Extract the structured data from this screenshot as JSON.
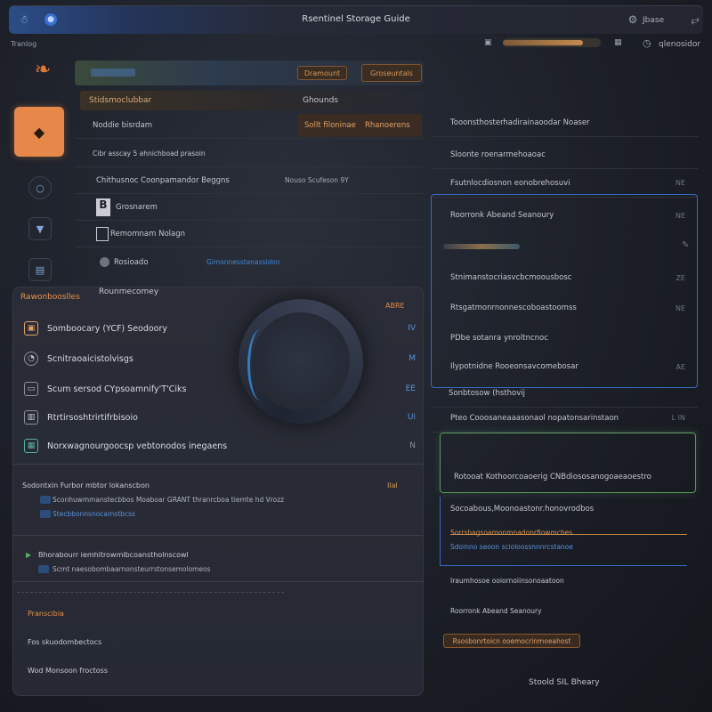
{
  "window": {
    "title": "Rsentinel Storage Guide",
    "user_name": "Jbase"
  },
  "menu": {
    "label": "Tranlog",
    "progress": 0.82,
    "account_label": "qlenosidor"
  },
  "header": {
    "action_small": "Dramount",
    "action_large": "Groseuntals"
  },
  "table": {
    "col_left": "Stidsmoclubbar",
    "col_right": "Ghounds",
    "highlight_a": "Sollt filoninae",
    "highlight_b": "Rhanoerens",
    "rows": [
      {
        "label": "Noddie bisrdam",
        "extra": ""
      },
      {
        "label": "Cibr asscay 5 ahnichboad prasoin",
        "extra": ""
      },
      {
        "label": "Chithusnoc Coonpamandor Beggns",
        "extra": "Nouso Scufeson 9Y"
      },
      {
        "label": "Grosnarem",
        "extra": ""
      },
      {
        "label": "Remomnam Nolagn",
        "extra": ""
      },
      {
        "label": "Rosioado",
        "extra": "Gimonnesstanassidon"
      }
    ]
  },
  "card": {
    "heading": "Rawonbooslles",
    "subheading": "Rounmecomey",
    "badge": "ABRE",
    "rows": [
      {
        "label": "Somboocary (YCF) Seodoory",
        "value": "IV"
      },
      {
        "label": "Scnitraoaicistolvisgs",
        "value": "M"
      },
      {
        "label": "Scum sersod CYpsoamnify'T'Ciks",
        "value": "EE"
      },
      {
        "label": "Rtrtirsoshtrirtifrbisoio",
        "value": "Ui"
      },
      {
        "label": "Norxwagnourgoocsp vebtonodos inegaens",
        "value": "N"
      }
    ],
    "section1_title": "Sodontxin Furbor mbtor lokanscbon",
    "section1_badge": "Ilal",
    "section1_line": "Sconhuwmmanstecbbos Moaboar GRANT thranrcboa tiemte hd Vrozz",
    "section1_link": "Stecbbonnsnocamstbcss",
    "section2_title": "Bhorabourr iemhitrowmlbcoanstholnscowl",
    "section2_line": "Scmt naesobombaarnonsteurrstonsemolomeos",
    "footer_orange": "Pranscibia",
    "footer_line1": "Fos skuodombectocs",
    "footer_line2": "Wod Monsoon froctoss"
  },
  "right": {
    "rows": [
      {
        "label": "Tooonsthosterhadirainaoodar Noaser",
        "value": ""
      },
      {
        "label": "Sloonte roenarmehoaoac",
        "value": ""
      },
      {
        "label": "Fsutnlocdiosnon eonobrehosuvi",
        "value": "NE"
      },
      {
        "label": "Roorronk Abeand Seanoury",
        "value": "NE"
      },
      {
        "label": "Stnimanstocriasvcbcmoousbosc",
        "value": "ZE"
      },
      {
        "label": "Rtsgatmonrnonnescoboastoomss",
        "value": "NE"
      },
      {
        "label": "PDbe sotanra ynroltncnoc",
        "value": ""
      },
      {
        "label": "Ilypotnidne Rooeonsavcomebosar",
        "value": "AE"
      },
      {
        "label": "Sonbtosow (hsthovij",
        "value": ""
      },
      {
        "label": "Pteo Cooosaneaaasonaol nopatonsarinstaon",
        "value": "L IN"
      },
      {
        "label": "Rotooat Kothoorcoaoerig CNBdiososanogoaeaoestro",
        "value": ""
      },
      {
        "label": "Socoabous,Moonoastonr.honovrodbos",
        "value": ""
      },
      {
        "label": "Sorrsbagsoamonmnadonrfiowmcbes",
        "value": ""
      },
      {
        "label": "Sdoinno seoon scioloossnnnrcstanoe",
        "value": ""
      },
      {
        "label": "Iraumhosoe ooiornoiinsonoaatoon",
        "value": ""
      }
    ],
    "button": "Rsosbonrtoicn ooemocrinmoeahost",
    "footer": "Stoold SIL Bheary"
  }
}
